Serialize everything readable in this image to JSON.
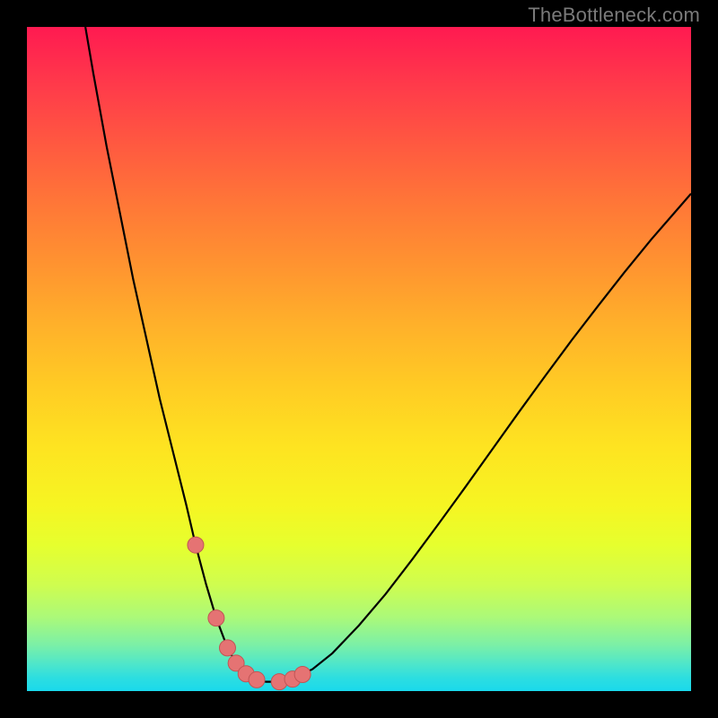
{
  "watermark": "TheBottleneck.com",
  "colors": {
    "frame": "#000000",
    "curve": "#000000",
    "marker_fill": "#e57373",
    "marker_stroke": "#c15555"
  },
  "chart_data": {
    "type": "line",
    "title": "",
    "xlabel": "",
    "ylabel": "",
    "xlim": [
      0,
      100
    ],
    "ylim": [
      0,
      100
    ],
    "series": [
      {
        "name": "bottleneck-curve",
        "x": [
          8.8,
          10,
          12,
          14,
          16,
          18,
          20,
          22,
          24,
          25.4,
          27,
          28.5,
          30.2,
          31.5,
          33,
          34.6,
          36,
          38,
          40,
          43,
          46,
          50,
          54,
          58,
          62,
          66,
          70,
          74,
          78,
          82,
          86,
          90,
          94,
          98,
          100
        ],
        "values": [
          100,
          93,
          82,
          72,
          62,
          53,
          44,
          36,
          28,
          22,
          16,
          11,
          6.5,
          4.2,
          2.6,
          1.7,
          1.4,
          1.4,
          1.8,
          3.3,
          5.7,
          9.9,
          14.6,
          19.8,
          25.2,
          30.7,
          36.3,
          41.9,
          47.4,
          52.8,
          58.0,
          63.1,
          68.0,
          72.6,
          74.9
        ]
      }
    ],
    "markers": {
      "name": "highlighted-points",
      "x": [
        25.4,
        28.5,
        30.2,
        31.5,
        33.0,
        34.6,
        38.0,
        40.0,
        41.5
      ],
      "values": [
        22.0,
        11.0,
        6.5,
        4.2,
        2.6,
        1.7,
        1.4,
        1.8,
        2.5
      ]
    }
  }
}
